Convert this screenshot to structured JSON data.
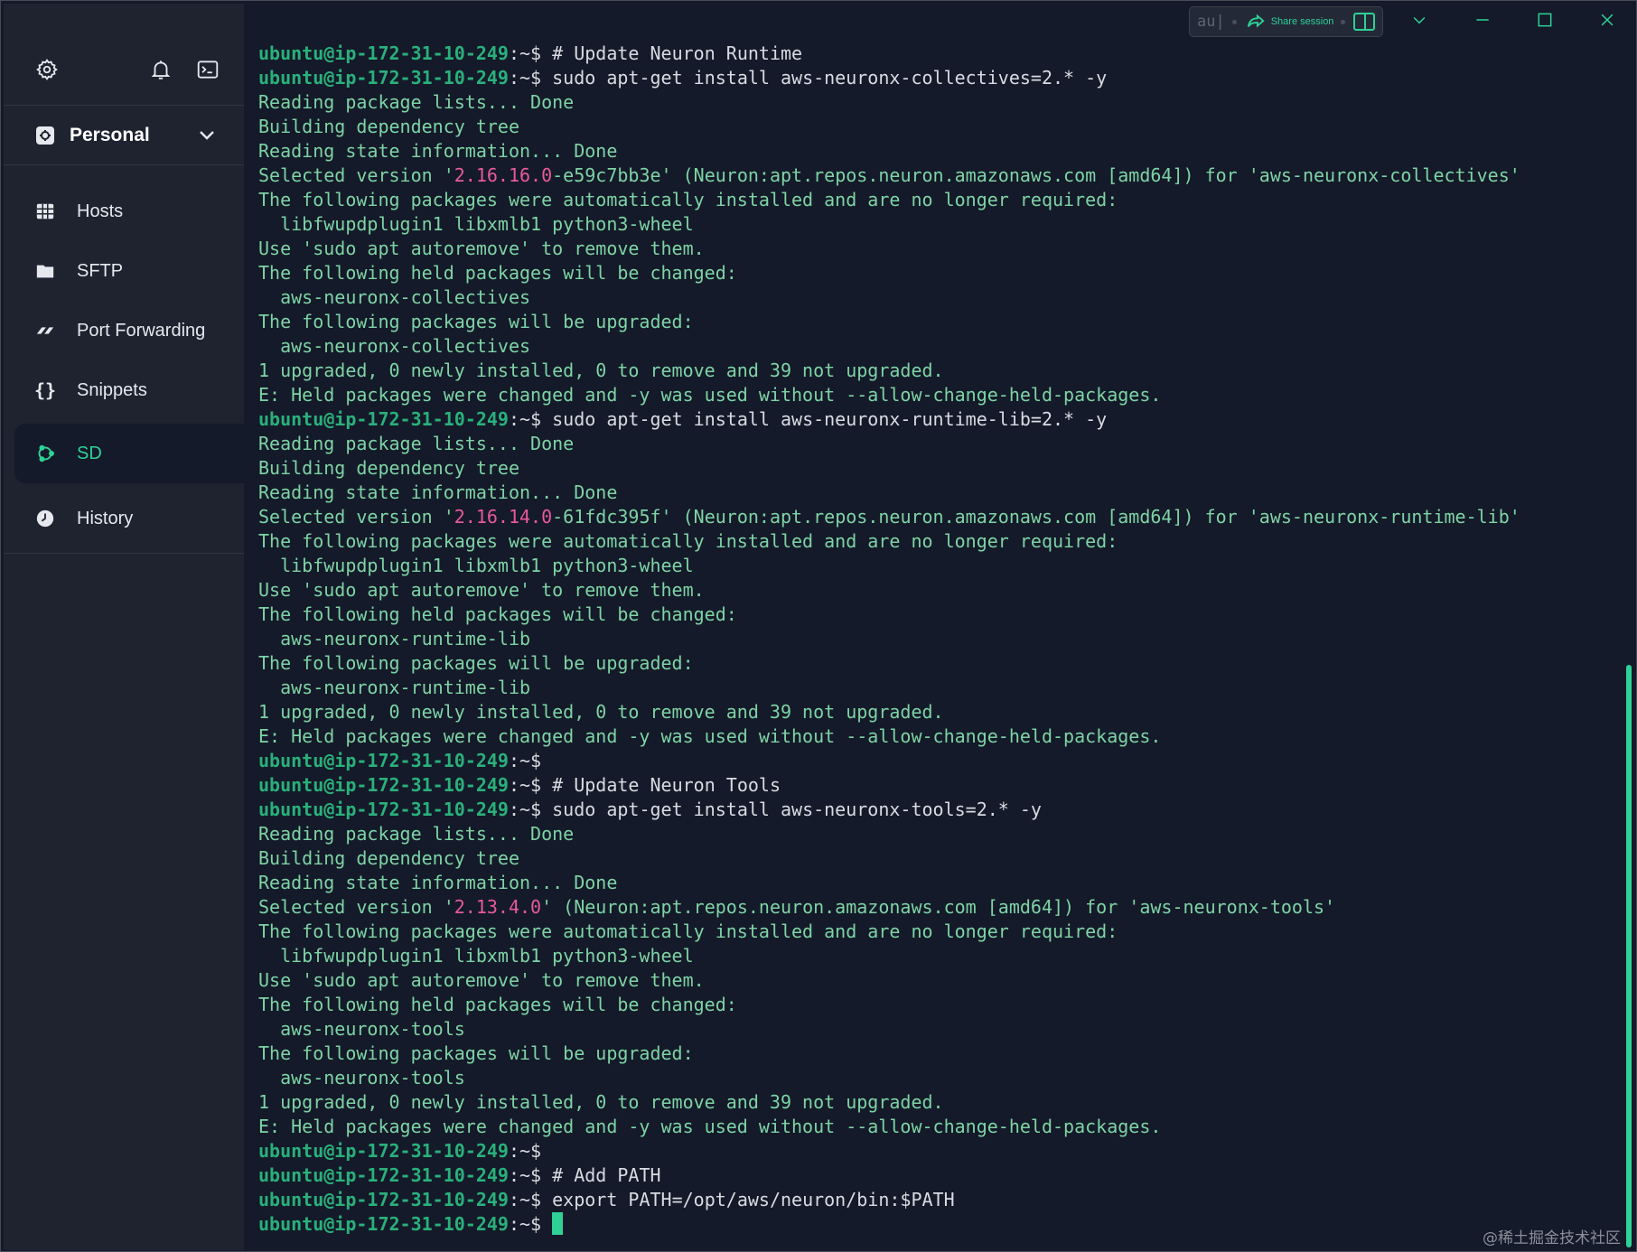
{
  "sidebar": {
    "top_icons": [
      "gear-icon",
      "bell-icon",
      "terminal-icon"
    ],
    "vault_label": "Personal",
    "items": [
      {
        "label": "Hosts",
        "icon": "hosts-grid-icon"
      },
      {
        "label": "SFTP",
        "icon": "folder-icon"
      },
      {
        "label": "Port Forwarding",
        "icon": "port-forward-icon"
      },
      {
        "label": "Snippets",
        "icon": "braces-icon"
      },
      {
        "label": "SD",
        "icon": "ubuntu-icon",
        "active": true
      },
      {
        "label": "History",
        "icon": "clock-icon"
      }
    ]
  },
  "titlebar": {
    "input_text": "au|",
    "share_label": "Share session"
  },
  "terminal": {
    "prompt_user": "ubuntu@ip-172-31-10-249",
    "prompt_sep": ":~$",
    "lines": [
      {
        "type": "prompt",
        "cmd": " # Update Neuron Runtime"
      },
      {
        "type": "prompt",
        "cmd": " sudo apt-get install aws-neuronx-collectives=2.* -y"
      },
      {
        "type": "out",
        "text": "Reading package lists... Done"
      },
      {
        "type": "out",
        "text": "Building dependency tree"
      },
      {
        "type": "out",
        "text": "Reading state information... Done"
      },
      {
        "type": "sel",
        "pre": "Selected version '",
        "ver": "2.16.16.0",
        "post": "-e59c7bb3e' (Neuron:apt.repos.neuron.amazonaws.com [amd64]) for 'aws-neuronx-collectives'"
      },
      {
        "type": "out",
        "text": "The following packages were automatically installed and are no longer required:"
      },
      {
        "type": "out",
        "text": "  libfwupdplugin1 libxmlb1 python3-wheel"
      },
      {
        "type": "out",
        "text": "Use 'sudo apt autoremove' to remove them."
      },
      {
        "type": "out",
        "text": "The following held packages will be changed:"
      },
      {
        "type": "out",
        "text": "  aws-neuronx-collectives"
      },
      {
        "type": "out",
        "text": "The following packages will be upgraded:"
      },
      {
        "type": "out",
        "text": "  aws-neuronx-collectives"
      },
      {
        "type": "out",
        "text": "1 upgraded, 0 newly installed, 0 to remove and 39 not upgraded."
      },
      {
        "type": "out",
        "text": "E: Held packages were changed and -y was used without --allow-change-held-packages."
      },
      {
        "type": "prompt",
        "cmd": " sudo apt-get install aws-neuronx-runtime-lib=2.* -y"
      },
      {
        "type": "out",
        "text": "Reading package lists... Done"
      },
      {
        "type": "out",
        "text": "Building dependency tree"
      },
      {
        "type": "out",
        "text": "Reading state information... Done"
      },
      {
        "type": "sel",
        "pre": "Selected version '",
        "ver": "2.16.14.0",
        "post": "-61fdc395f' (Neuron:apt.repos.neuron.amazonaws.com [amd64]) for 'aws-neuronx-runtime-lib'"
      },
      {
        "type": "out",
        "text": "The following packages were automatically installed and are no longer required:"
      },
      {
        "type": "out",
        "text": "  libfwupdplugin1 libxmlb1 python3-wheel"
      },
      {
        "type": "out",
        "text": "Use 'sudo apt autoremove' to remove them."
      },
      {
        "type": "out",
        "text": "The following held packages will be changed:"
      },
      {
        "type": "out",
        "text": "  aws-neuronx-runtime-lib"
      },
      {
        "type": "out",
        "text": "The following packages will be upgraded:"
      },
      {
        "type": "out",
        "text": "  aws-neuronx-runtime-lib"
      },
      {
        "type": "out",
        "text": "1 upgraded, 0 newly installed, 0 to remove and 39 not upgraded."
      },
      {
        "type": "out",
        "text": "E: Held packages were changed and -y was used without --allow-change-held-packages."
      },
      {
        "type": "prompt",
        "cmd": ""
      },
      {
        "type": "prompt",
        "cmd": " # Update Neuron Tools"
      },
      {
        "type": "prompt",
        "cmd": " sudo apt-get install aws-neuronx-tools=2.* -y"
      },
      {
        "type": "out",
        "text": "Reading package lists... Done"
      },
      {
        "type": "out",
        "text": "Building dependency tree"
      },
      {
        "type": "out",
        "text": "Reading state information... Done"
      },
      {
        "type": "sel",
        "pre": "Selected version '",
        "ver": "2.13.4.0",
        "post": "' (Neuron:apt.repos.neuron.amazonaws.com [amd64]) for 'aws-neuronx-tools'"
      },
      {
        "type": "out",
        "text": "The following packages were automatically installed and are no longer required:"
      },
      {
        "type": "out",
        "text": "  libfwupdplugin1 libxmlb1 python3-wheel"
      },
      {
        "type": "out",
        "text": "Use 'sudo apt autoremove' to remove them."
      },
      {
        "type": "out",
        "text": "The following held packages will be changed:"
      },
      {
        "type": "out",
        "text": "  aws-neuronx-tools"
      },
      {
        "type": "out",
        "text": "The following packages will be upgraded:"
      },
      {
        "type": "out",
        "text": "  aws-neuronx-tools"
      },
      {
        "type": "out",
        "text": "1 upgraded, 0 newly installed, 0 to remove and 39 not upgraded."
      },
      {
        "type": "out",
        "text": "E: Held packages were changed and -y was used without --allow-change-held-packages."
      },
      {
        "type": "prompt",
        "cmd": ""
      },
      {
        "type": "prompt",
        "cmd": " # Add PATH"
      },
      {
        "type": "prompt",
        "cmd": " export PATH=/opt/aws/neuron/bin:$PATH"
      },
      {
        "type": "prompt",
        "cmd": " ",
        "cursor": true
      }
    ]
  },
  "watermark": "@稀土掘金技术社区",
  "colors": {
    "accent": "#2ed196",
    "prompt": "#2ab07b",
    "output": "#7ed3a5",
    "version": "#e85a9a",
    "sidebar_bg": "#1f2330",
    "terminal_bg": "#141a29"
  }
}
